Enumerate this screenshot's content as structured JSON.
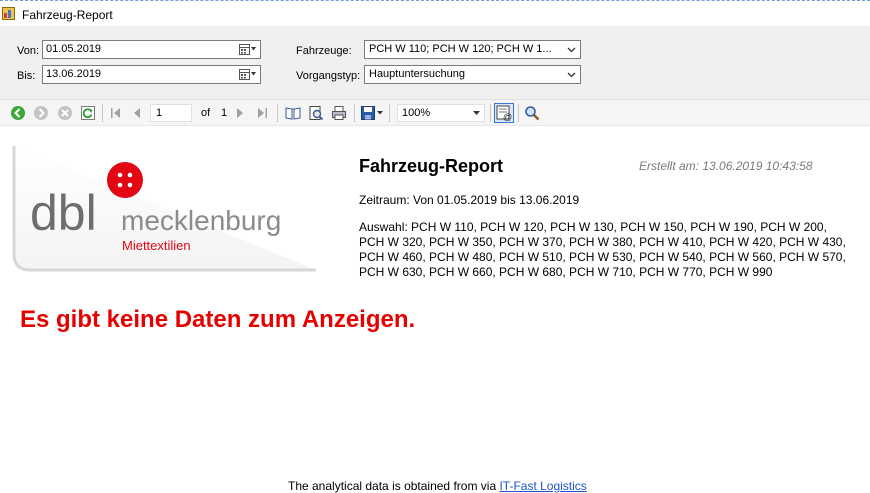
{
  "window": {
    "title": "Fahrzeug-Report"
  },
  "filters": {
    "von_label": "Von:",
    "von_value": "01.05.2019",
    "bis_label": "Bis:",
    "bis_value": "13.06.2019",
    "fahrzeuge_label": "Fahrzeuge:",
    "fahrzeuge_value": "PCH W 110; PCH W 120; PCH W 1...",
    "vorgangstyp_label": "Vorgangstyp:",
    "vorgangstyp_value": "Hauptuntersuchung"
  },
  "toolbar": {
    "page_current": "1",
    "page_of_label": "of",
    "page_total": "1",
    "zoom": "100%",
    "icons": [
      "back-icon",
      "forward-icon",
      "stop-icon",
      "refresh-icon",
      "first-page-icon",
      "previous-page-icon",
      "next-page-icon",
      "last-page-icon",
      "document-map-icon",
      "print-layout-icon",
      "print-icon",
      "save-icon",
      "page-setup-icon",
      "search-icon"
    ]
  },
  "report": {
    "logo_brand": "dbl",
    "logo_name": "mecklenburg",
    "logo_tagline": "Miettextilien",
    "title": "Fahrzeug-Report",
    "created": "Erstellt am: 13.06.2019 10:43:58",
    "period": "Zeitraum: Von 01.05.2019 bis 13.06.2019",
    "selection": "Auswahl: PCH W 110, PCH W 120, PCH W 130, PCH W 150, PCH W 190, PCH W 200, PCH W 320, PCH W 350, PCH W 370, PCH W 380, PCH W 410, PCH W 420, PCH W 430, PCH W 460, PCH W 480, PCH W 510, PCH W 530, PCH W 540, PCH W 560, PCH W 570, PCH W 630, PCH W 660, PCH W 680, PCH W 710, PCH W 770, PCH W 990",
    "no_data": "Es gibt keine Daten zum Anzeigen.",
    "footer_text": "The analytical data is obtained from via ",
    "footer_link": "IT-Fast Logistics"
  },
  "colors": {
    "accent_red": "#e30613",
    "no_data_red": "#e60000",
    "logo_gray": "#6d6e70",
    "panel_bg": "#f0f0f0"
  }
}
